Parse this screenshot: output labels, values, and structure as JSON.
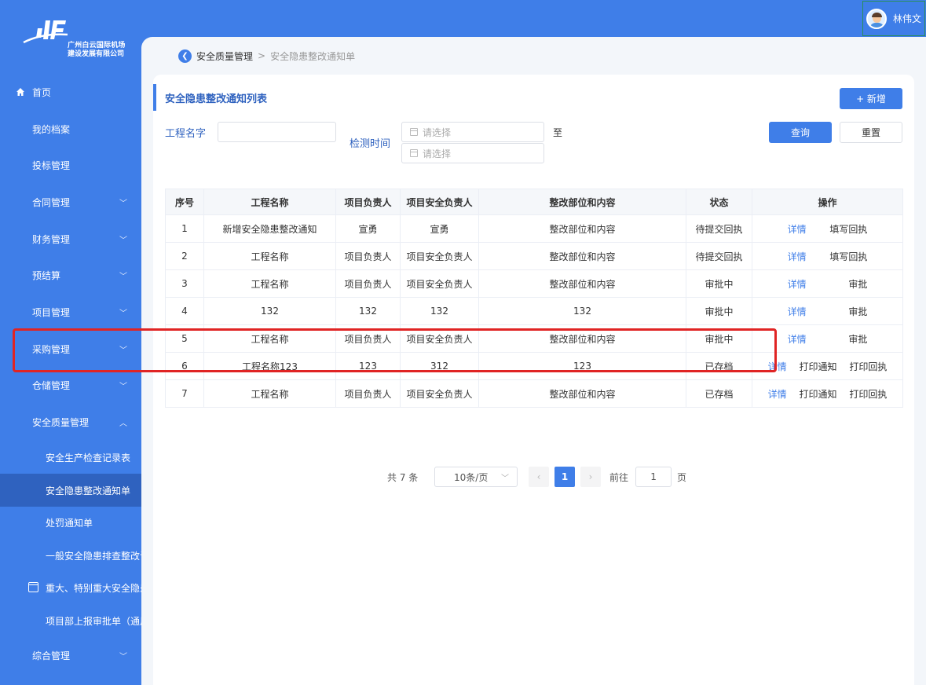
{
  "header": {
    "user_name": "林伟文"
  },
  "logo": {
    "line1": "广州白云国际机场",
    "line2": "建设发展有限公司"
  },
  "sidebar": {
    "items": [
      {
        "label": "首页"
      },
      {
        "label": "我的档案"
      },
      {
        "label": "投标管理"
      },
      {
        "label": "合同管理"
      },
      {
        "label": "财务管理"
      },
      {
        "label": "预结算"
      },
      {
        "label": "项目管理"
      },
      {
        "label": "采购管理"
      },
      {
        "label": "仓储管理"
      },
      {
        "label": "安全质量管理"
      },
      {
        "label": "安全生产检查记录表"
      },
      {
        "label": "安全隐患整改通知单"
      },
      {
        "label": "处罚通知单"
      },
      {
        "label": "一般安全隐患排查整改记录"
      },
      {
        "label": "重大、特别重大安全隐患排查整改记录"
      },
      {
        "label": "项目部上报审批单（通用）"
      },
      {
        "label": "综合管理"
      }
    ]
  },
  "breadcrumb": {
    "parent": "安全质量管理",
    "separator": ">",
    "current": "安全隐患整改通知单"
  },
  "page": {
    "title": "安全隐患整改通知列表",
    "add_label": "+ 新增",
    "query_label": "查询",
    "reset_label": "重置"
  },
  "filters": {
    "project_name_label": "工程名字",
    "project_name_value": "",
    "check_time_label": "检测时间",
    "date_placeholder": "请选择",
    "to_label": "至"
  },
  "table": {
    "headers": [
      "序号",
      "工程名称",
      "项目负责人",
      "项目安全负责人",
      "整改部位和内容",
      "状态",
      "操作"
    ],
    "rows": [
      {
        "no": "1",
        "name": "新增安全隐患整改通知",
        "leader": "宣勇",
        "safety": "宣勇",
        "content": "整改部位和内容",
        "status": "待提交回执",
        "ops": [
          "详情",
          "填写回执"
        ]
      },
      {
        "no": "2",
        "name": "工程名称",
        "leader": "项目负责人",
        "safety": "项目安全负责人",
        "content": "整改部位和内容",
        "status": "待提交回执",
        "ops": [
          "详情",
          "填写回执"
        ]
      },
      {
        "no": "3",
        "name": "工程名称",
        "leader": "项目负责人",
        "safety": "项目安全负责人",
        "content": "整改部位和内容",
        "status": "审批中",
        "ops": [
          "详情",
          "审批"
        ]
      },
      {
        "no": "4",
        "name": "132",
        "leader": "132",
        "safety": "132",
        "content": "132",
        "status": "审批中",
        "ops": [
          "详情",
          "审批"
        ]
      },
      {
        "no": "5",
        "name": "工程名称",
        "leader": "项目负责人",
        "safety": "项目安全负责人",
        "content": "整改部位和内容",
        "status": "审批中",
        "ops": [
          "详情",
          "审批"
        ]
      },
      {
        "no": "6",
        "name": "工程名称123",
        "leader": "123",
        "safety": "312",
        "content": "123",
        "status": "已存档",
        "ops": [
          "详情",
          "打印通知",
          "打印回执"
        ]
      },
      {
        "no": "7",
        "name": "工程名称",
        "leader": "项目负责人",
        "safety": "项目安全负责人",
        "content": "整改部位和内容",
        "status": "已存档",
        "ops": [
          "详情",
          "打印通知",
          "打印回执"
        ]
      }
    ]
  },
  "pagination": {
    "total": "共 7 条",
    "page_size": "10条/页",
    "current_page": "1",
    "goto_label": "前往",
    "goto_value": "1",
    "page_suffix": "页"
  },
  "colors": {
    "primary": "#3f7ee8",
    "highlight": "#e02424",
    "pending": "#e6a23c"
  }
}
